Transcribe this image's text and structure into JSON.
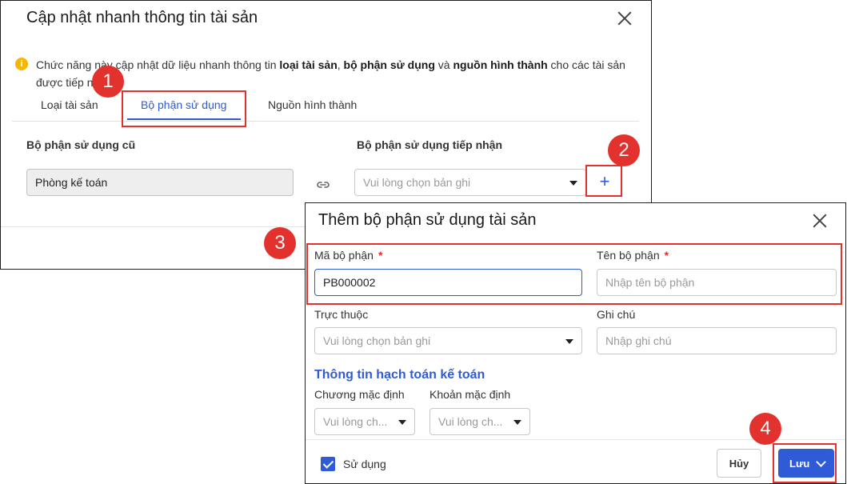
{
  "dialog1": {
    "title": "Cập nhật nhanh thông tin tài sản",
    "info": {
      "part1": "Chức năng này cập nhật dữ liệu nhanh thông tin ",
      "b1": "loại tài sản",
      "sep1": ", ",
      "b2": "bộ phận sử dụng",
      "part2": " và ",
      "b3": "nguồn hình thành",
      "part3": " cho các tài sản được tiếp nhận."
    },
    "tabs": [
      "Loại tài sản",
      "Bộ phận sử dụng",
      "Nguồn hình thành"
    ],
    "active_tab": "Bộ phận sử dụng",
    "old_label": "Bộ phận sử dụng cũ",
    "old_value": "Phòng kế toán",
    "new_label": "Bộ phận sử dụng tiếp nhận",
    "new_placeholder": "Vui lòng chọn bản ghi",
    "add_symbol": "+"
  },
  "dialog2": {
    "title": "Thêm bộ phận sử dụng tài sản",
    "code_label": "Mã bộ phận",
    "code_value": "PB000002",
    "name_label": "Tên bộ phận",
    "name_placeholder": "Nhập tên bộ phận",
    "required_mark": "*",
    "parent_label": "Trực thuộc",
    "parent_placeholder": "Vui lòng chọn bản ghi",
    "note_label": "Ghi chú",
    "note_placeholder": "Nhập ghi chú",
    "accounting_title": "Thông tin hạch toán kế toán",
    "default_channel_label": "Chương mặc định",
    "default_channel_placeholder": "Vui lòng ch...",
    "default_item_label": "Khoản mặc định",
    "default_item_placeholder": "Vui lòng ch...",
    "in_use_label": "Sử dụng",
    "in_use_checked": true,
    "cancel_label": "Hủy",
    "save_label": "Lưu"
  },
  "badges": [
    "1",
    "2",
    "3",
    "4"
  ],
  "colors": {
    "accent": "#2f5bd6",
    "highlight": "#e3312d",
    "info": "#f5b700"
  }
}
